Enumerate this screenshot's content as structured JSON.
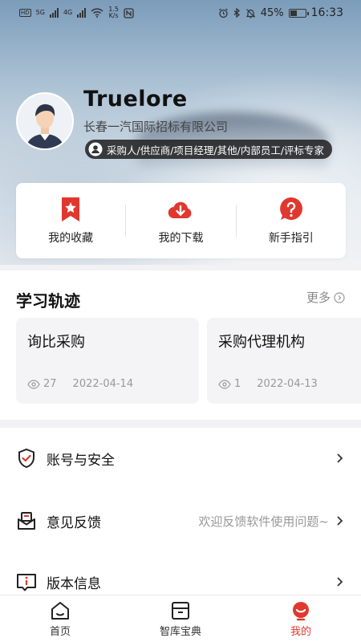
{
  "status_bar": {
    "signal1": "5G",
    "signal2": "4G",
    "net_speed_value": "1.5",
    "net_speed_unit": "K/s",
    "battery": "45%",
    "time": "16:33",
    "battery_level": 0.45
  },
  "profile": {
    "username": "Truelore",
    "company": "长春一汽国际招标有限公司",
    "roles": "采购人/供应商/项目经理/其他/内部员工/评标专家"
  },
  "quick_actions": [
    {
      "label": "我的收藏",
      "icon": "bookmark-star-icon"
    },
    {
      "label": "我的下载",
      "icon": "cloud-download-icon"
    },
    {
      "label": "新手指引",
      "icon": "question-icon"
    }
  ],
  "learning": {
    "title": "学习轨迹",
    "more": "更多",
    "cards": [
      {
        "title": "询比采购",
        "views": "27",
        "date": "2022-04-14"
      },
      {
        "title": "采购代理机构",
        "views": "1",
        "date": "2022-04-13"
      }
    ]
  },
  "menu": [
    {
      "label": "账号与安全",
      "hint": "",
      "icon": "shield-check-icon"
    },
    {
      "label": "意见反馈",
      "hint": "欢迎反馈软件使用问题~",
      "icon": "feedback-mail-icon"
    },
    {
      "label": "版本信息",
      "hint": "",
      "icon": "info-icon"
    }
  ],
  "bottom_nav": [
    {
      "label": "首页",
      "icon": "home-icon",
      "active": false
    },
    {
      "label": "智库宝典",
      "icon": "book-box-icon",
      "active": false
    },
    {
      "label": "我的",
      "icon": "profile-icon",
      "active": true
    }
  ],
  "colors": {
    "accent": "#e0382f",
    "text": "#111111",
    "muted": "#999999"
  }
}
